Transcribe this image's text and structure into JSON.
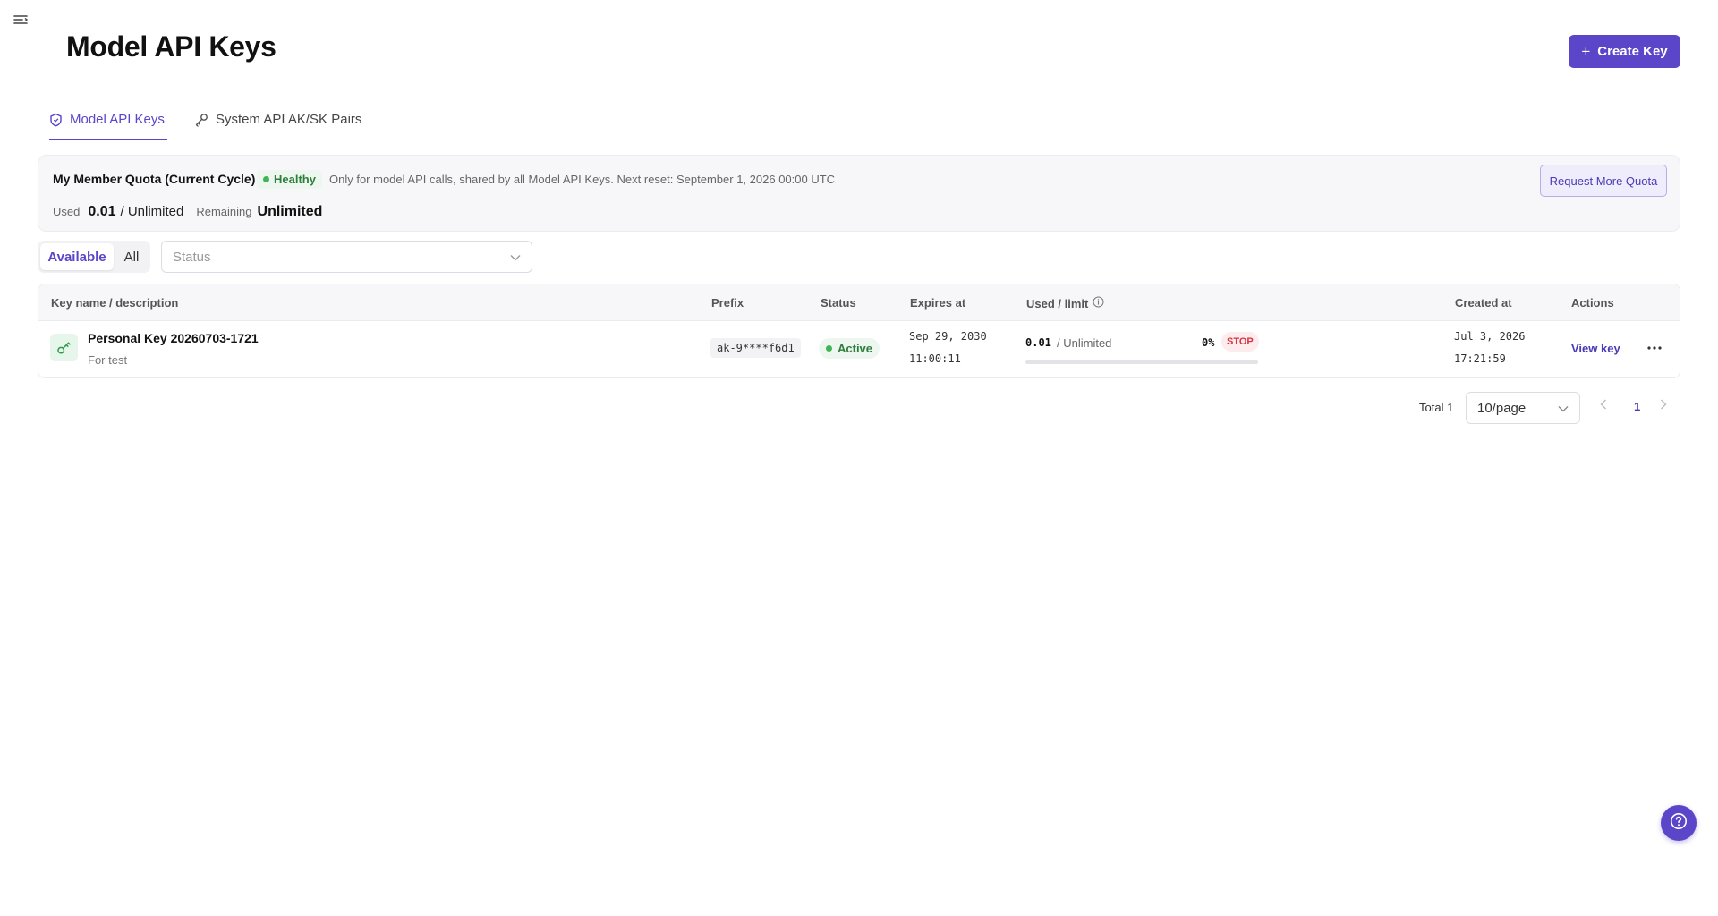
{
  "header": {
    "title": "Model API Keys",
    "create_label": "Create Key"
  },
  "tabs": [
    {
      "label": "Model API Keys",
      "active": true,
      "icon": "shield-icon"
    },
    {
      "label": "System API AK/SK Pairs",
      "active": false,
      "icon": "key-icon"
    }
  ],
  "quota": {
    "title": "My Member Quota (Current Cycle)",
    "status": "Healthy",
    "note": "Only for model API calls, shared by all Model API Keys. Next reset: September 1, 2026 00:00 UTC",
    "used_label": "Used",
    "used_value": "0.01",
    "used_limit": "/ Unlimited",
    "remaining_label": "Remaining",
    "remaining_value": "Unlimited",
    "request_label": "Request More Quota"
  },
  "filters": {
    "segments": [
      "Available",
      "All"
    ],
    "selected_segment": "Available",
    "status_placeholder": "Status"
  },
  "table": {
    "columns": [
      "Key name / description",
      "Prefix",
      "Status",
      "Expires at",
      "Used / limit",
      "Created at",
      "Actions"
    ],
    "rows": [
      {
        "name": "Personal Key 20260703-1721",
        "description": "For test",
        "prefix": "ak-9****f6d1",
        "status": "Active",
        "expires_date": "Sep 29, 2030",
        "expires_time": "11:00:11",
        "used": "0.01",
        "limit": "/ Unlimited",
        "percent": "0%",
        "percent_value": 0,
        "badge": "STOP",
        "created_date": "Jul 3, 2026",
        "created_time": "17:21:59",
        "action": "View key"
      }
    ]
  },
  "pagination": {
    "total": "Total 1",
    "page_size": "10/page",
    "current_page": "1"
  },
  "colors": {
    "accent": "#5b45c9",
    "success": "#2e7d3a",
    "danger": "#d9343f"
  }
}
